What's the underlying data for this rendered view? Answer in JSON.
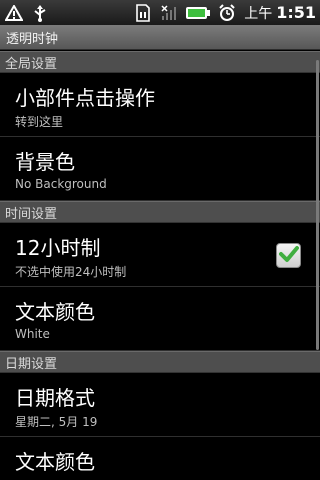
{
  "status": {
    "ampm": "上午",
    "time": "1:51"
  },
  "app": {
    "title": "透明时钟"
  },
  "sections": [
    {
      "header": "全局设置",
      "items": [
        {
          "title": "小部件点击操作",
          "summary": "转到这里"
        },
        {
          "title": "背景色",
          "summary": "No Background"
        }
      ]
    },
    {
      "header": "时间设置",
      "items": [
        {
          "title": "12小时制",
          "summary": "不选中使用24小时制",
          "checked": true
        },
        {
          "title": "文本颜色",
          "summary": "White"
        }
      ]
    },
    {
      "header": "日期设置",
      "items": [
        {
          "title": "日期格式",
          "summary": "星期二, 5月 19"
        },
        {
          "title": "文本颜色",
          "summary": ""
        }
      ]
    }
  ],
  "colors": {
    "check_green": "#3fae3f"
  },
  "icons": [
    "warning-icon",
    "usb-icon",
    "sim-icon",
    "no-signal-icon",
    "battery-icon",
    "alarm-icon",
    "check-icon"
  ]
}
